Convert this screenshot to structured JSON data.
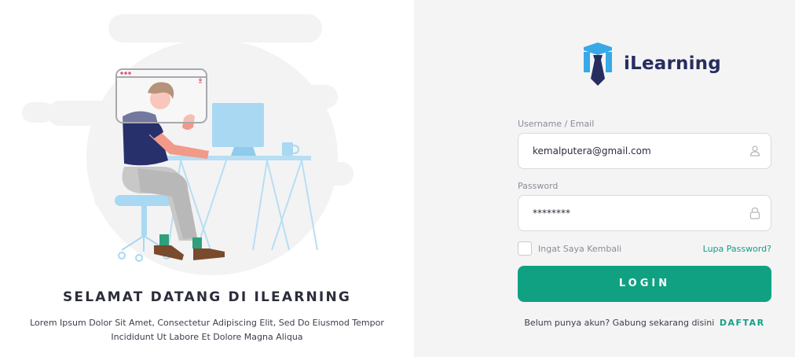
{
  "welcome": {
    "title": "SELAMAT DATANG DI ILEARNING",
    "description_line1": "Lorem Ipsum Dolor Sit Amet, Consectetur Adipiscing Elit, Sed Do Eiusmod Tempor",
    "description_line2": "Incididunt Ut Labore Et Dolore Magna Aliqua"
  },
  "brand": {
    "name": "iLearning",
    "logo_icon": "graduation-tie-logo-icon"
  },
  "login_form": {
    "username_label": "Username / Email",
    "username_value": "kemalputera@gmail.com",
    "username_icon": "user-icon",
    "password_label": "Password",
    "password_value": "********",
    "password_icon": "lock-icon",
    "remember_label": "Ingat Saya Kembali",
    "remember_checked": false,
    "forgot_link": "Lupa Password?",
    "login_button": "LOGIN",
    "signup_prompt": "Belum punya akun? Gabung sekarang disini",
    "signup_link": "DAFTAR"
  },
  "colors": {
    "primary": "#10a182",
    "brand_dark": "#262d5f",
    "logo_blue": "#38a9e6",
    "panel_background": "#f4f4f5"
  }
}
